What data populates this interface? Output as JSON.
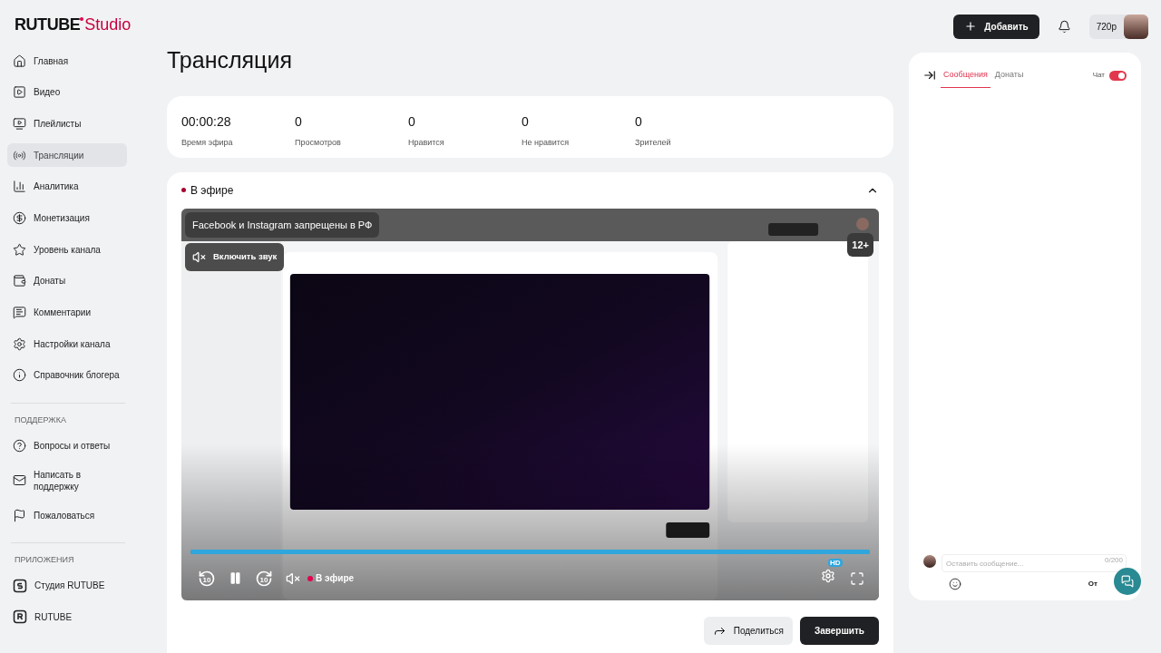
{
  "brand": {
    "name": "RUTUBE",
    "suffix": "Studio"
  },
  "header": {
    "add_button": "Добавить",
    "quality": "720р"
  },
  "sidebar": {
    "sections": [
      {
        "items": [
          {
            "label": "Главная",
            "selected": false
          },
          {
            "label": "Видео",
            "selected": false
          },
          {
            "label": "Плейлисты",
            "selected": false
          },
          {
            "label": "Трансляции",
            "selected": true
          },
          {
            "label": "Аналитика",
            "selected": false
          },
          {
            "label": "Монетизация",
            "selected": false
          },
          {
            "label": "Уровень канала",
            "selected": false
          },
          {
            "label": "Донаты",
            "selected": false
          },
          {
            "label": "Комментарии",
            "selected": false
          },
          {
            "label": "Настройки канала",
            "selected": false
          },
          {
            "label": "Справочник блогера",
            "selected": false
          }
        ]
      },
      {
        "heading": "ПОДДЕРЖКА",
        "items": [
          {
            "label": "Вопросы и ответы",
            "selected": false
          },
          {
            "label": "Написать в поддержку",
            "selected": false
          },
          {
            "label": "Пожаловаться",
            "selected": false
          }
        ]
      },
      {
        "heading": "ПРИЛОЖЕНИЯ",
        "items": [
          {
            "label": "Студия RUTUBE",
            "selected": false
          },
          {
            "label": "RUTUBE",
            "selected": false
          }
        ]
      }
    ]
  },
  "page_title": "Трансляция",
  "stats": [
    {
      "value": "00:00:28",
      "label": "Время эфира"
    },
    {
      "value": "0",
      "label": "Просмотров"
    },
    {
      "value": "0",
      "label": "Нравится"
    },
    {
      "value": "0",
      "label": "Не нравится"
    },
    {
      "value": "0",
      "label": "Зрителей"
    }
  ],
  "live": {
    "status": "В эфире",
    "expanded": true,
    "player": {
      "notice": "Facebook и Instagram запрещены в РФ",
      "unmute_button": "Включить звук",
      "age_rating": "12+",
      "progress": {
        "level": 1
      },
      "rewind_label": "10",
      "forward_label": "10",
      "status": "В эфире",
      "quality_badge": "HD"
    },
    "buttons": {
      "share": "Поделиться",
      "finish": "Завершить"
    }
  },
  "chat": {
    "tabs": [
      {
        "label": "Сообщения",
        "selected": true
      },
      {
        "label": "Донаты",
        "selected": false
      }
    ],
    "chat_toggle": {
      "label": "Чат",
      "on": true
    },
    "input": {
      "placeholder": "Оставить сообщение...",
      "counter": "0/200"
    },
    "send_button": "От"
  }
}
